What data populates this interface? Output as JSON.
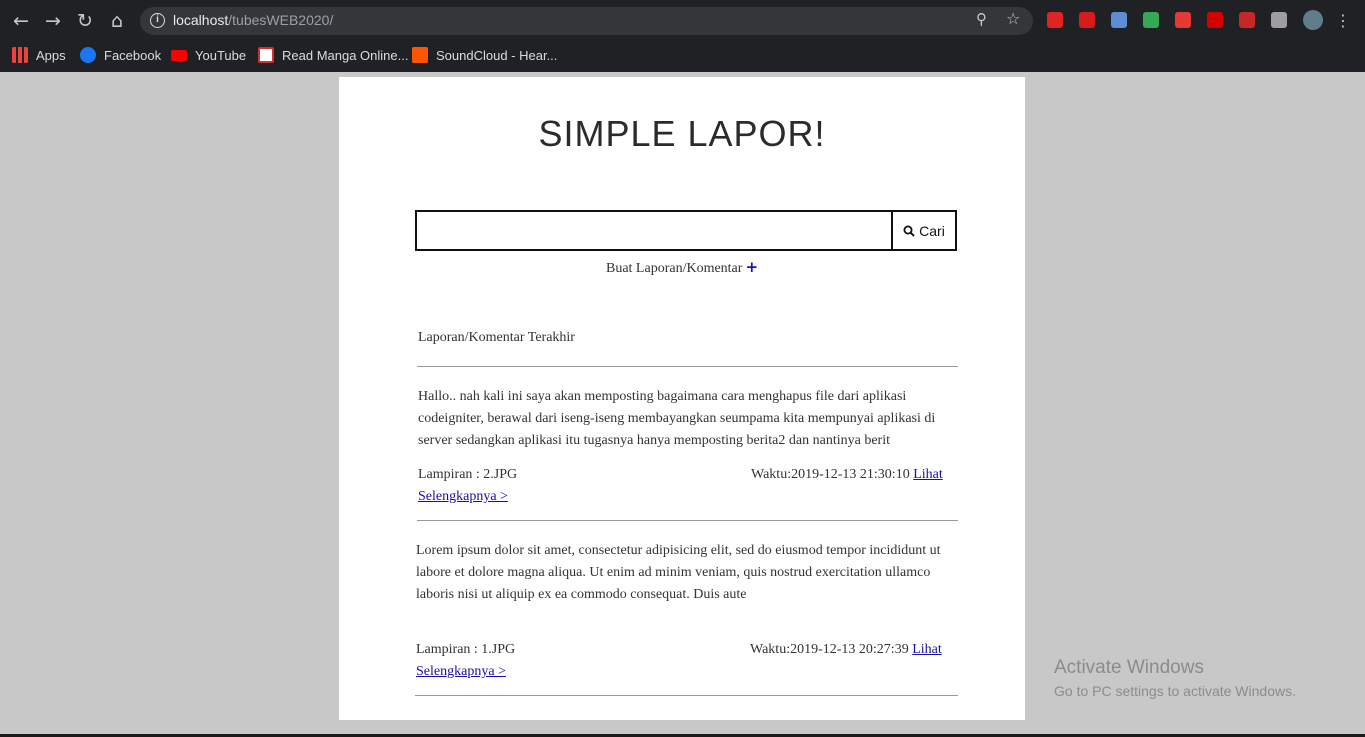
{
  "browser": {
    "url_host": "localhost",
    "url_path": "/tubesWEB2020/",
    "bookmarks": [
      {
        "label": "Apps",
        "icon": "apps-grid-icon",
        "color": "#e8453c"
      },
      {
        "label": "Facebook",
        "icon": "facebook-icon",
        "color": "#1877f2"
      },
      {
        "label": "YouTube",
        "icon": "youtube-icon",
        "color": "#ff0000"
      },
      {
        "label": "Read Manga Online...",
        "icon": "manga-site-icon",
        "color": "#d32f2f"
      },
      {
        "label": "SoundCloud - Hear...",
        "icon": "soundcloud-icon",
        "color": "#ff5500"
      }
    ],
    "extension_colors": [
      "#e02424",
      "#d81b1b",
      "#5f8dd3",
      "#34a853",
      "#e53935",
      "#d50000",
      "#c62828",
      "#9e9e9e",
      "#607d8b"
    ]
  },
  "page": {
    "title": "SIMPLE LAPOR!",
    "search": {
      "value": "",
      "button_label": "Cari"
    },
    "create_link": "Buat Laporan/Komentar",
    "section_heading": "Laporan/Komentar Terakhir",
    "posts": [
      {
        "text": "Hallo.. nah kali ini saya akan memposting bagaimana cara menghapus file dari aplikasi codeigniter, berawal dari iseng-iseng membayangkan seumpama kita mempunyai aplikasi di server sedangkan aplikasi itu tugasnya hanya memposting berita2 dan nantinya berit",
        "attachment": "Lampiran : 2.JPG",
        "time": "Waktu:2019-12-13 21:30:10",
        "link_word": "Lihat",
        "link_rest": "Selengkapnya >"
      },
      {
        "text": "Lorem ipsum dolor sit amet, consectetur adipisicing elit, sed do eiusmod tempor incididunt ut labore et dolore magna aliqua. Ut enim ad minim veniam, quis nostrud exercitation ullamco laboris nisi ut aliquip ex ea commodo consequat. Duis aute",
        "attachment": "Lampiran : 1.JPG",
        "time": "Waktu:2019-12-13 20:27:39",
        "link_word": "Lihat",
        "link_rest": "Selengkapnya >"
      }
    ]
  },
  "windows_watermark": {
    "title": "Activate Windows",
    "subtitle": "Go to PC settings to activate Windows."
  }
}
